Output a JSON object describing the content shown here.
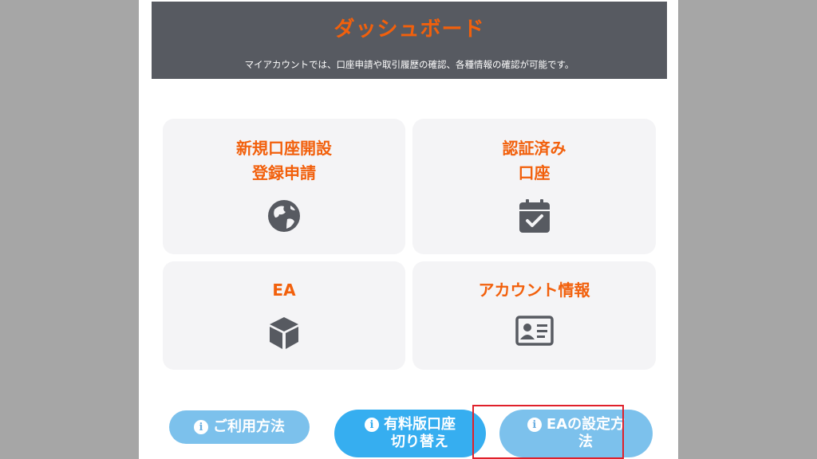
{
  "header": {
    "title": "ダッシュボード",
    "subtitle": "マイアカウントでは、口座申請や取引履歴の確認、各種情報の確認が可能です。"
  },
  "cards": [
    {
      "title": "新規口座開設\n登録申請",
      "icon": "globe-icon"
    },
    {
      "title": "認証済み\n口座",
      "icon": "calendar-check-icon"
    },
    {
      "title": "EA",
      "icon": "cube-icon"
    },
    {
      "title": "アカウント情報",
      "icon": "id-card-icon"
    }
  ],
  "buttons": [
    {
      "label": "ご利用方法",
      "icon": "info-icon"
    },
    {
      "label": "有料版口座\n切り替え",
      "icon": "info-icon"
    },
    {
      "label": "EAの設定方\n法",
      "icon": "info-icon"
    }
  ],
  "colors": {
    "accent": "#f2600c",
    "header_bg": "#575a61",
    "card_bg": "#f4f4f6",
    "button_bg": "#7cc1ec",
    "button_active_bg": "#36aef0",
    "highlight_frame": "#e0202a"
  }
}
